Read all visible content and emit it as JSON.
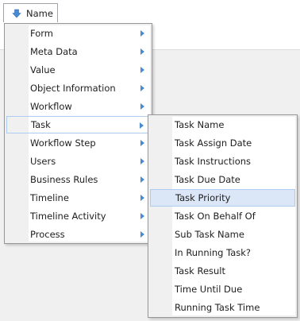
{
  "column_header": {
    "label": "Name",
    "icon": "sort-down-arrow-icon"
  },
  "main_menu": {
    "items": [
      {
        "label": "Form"
      },
      {
        "label": "Meta Data"
      },
      {
        "label": "Value"
      },
      {
        "label": "Object Information"
      },
      {
        "label": "Workflow"
      },
      {
        "label": "Task",
        "highlighted": true
      },
      {
        "label": "Workflow Step"
      },
      {
        "label": "Users"
      },
      {
        "label": "Business Rules"
      },
      {
        "label": "Timeline"
      },
      {
        "label": "Timeline Activity"
      },
      {
        "label": "Process"
      }
    ]
  },
  "task_submenu": {
    "items": [
      {
        "label": "Task Name"
      },
      {
        "label": "Task Assign Date"
      },
      {
        "label": "Task Instructions"
      },
      {
        "label": "Task Due Date"
      },
      {
        "label": "Task Priority",
        "highlighted": true
      },
      {
        "label": "Task On Behalf Of"
      },
      {
        "label": "Sub Task Name"
      },
      {
        "label": "In Running Task?"
      },
      {
        "label": "Task Result"
      },
      {
        "label": "Time Until Due"
      },
      {
        "label": "Running Task Time"
      }
    ]
  },
  "colors": {
    "highlight_fill": "#dbe7f7",
    "highlight_border": "#aecbf0",
    "menu_border": "#979797",
    "arrow_icon": "#4a8ad4"
  }
}
